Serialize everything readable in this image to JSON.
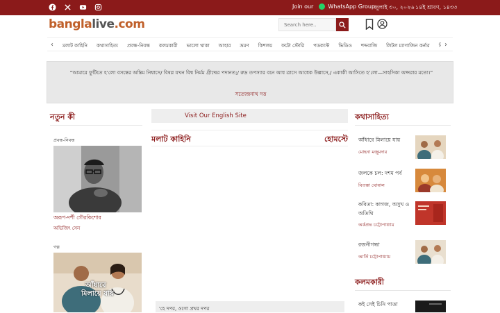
{
  "topbar": {
    "social_icons": [
      "facebook-icon",
      "x-icon",
      "youtube-icon",
      "instagram-icon"
    ],
    "join_label": "Join our",
    "whatsapp_label": "WhatsApp Group",
    "date_bn": "জুলাই ৩০, ২০২৬",
    "date_bangla_calendar": "১৪ই শ্রাবণ, ১৪৩৩"
  },
  "header": {
    "logo": {
      "part1": "bangla",
      "part2": "live",
      "part3": ".com"
    },
    "search_placeholder": "Search here.."
  },
  "nav": {
    "items": [
      "মলাট কাহিনি",
      "কথাসাহিত্য",
      "প্রবন্ধ-নিবন্ধ",
      "কলমকারী",
      "ভালো থাকা",
      "আহার",
      "ভ্রমণ",
      "কিশলয়",
      "ফটো স্টোরি",
      "পডকাস্ট",
      "ভিডিও",
      "শব্দবাজি",
      "লিটল ম্যাগাজিন কর্নার",
      "বিশেষ"
    ]
  },
  "quote": {
    "text": "“আমারে ফুটিতে হ’লো বসন্তের অন্তিম নিশ্বাসে/ বিষণ্ণ যখন বিশ্ব নির্মম গ্রীষ্মের পদানত;/ রুদ্র তপস্যার বনে আধ ত্রাসে আধেক উল্লাসে,/ একাকী আসিতে হ’লো—সাহসিকা অপ্সরার মতো।”",
    "author": "সত্যেন্দ্রনাথ দত্ত"
  },
  "left": {
    "title": "নতুন কী",
    "cards": [
      {
        "category": "প্রবন্ধ-নিবন্ধ",
        "title": "অরূপ-দর্শী গৌরকিশোর",
        "author": "অভিজিৎ সেন"
      },
      {
        "category": "গল্প",
        "image_caption_1": "আঁধারে",
        "image_caption_2": "মিলায়ে যায়"
      }
    ]
  },
  "center": {
    "visit_label": "Visit Our English Site",
    "section_title": "মলাট কাহিনি",
    "section_link": "হোমস্টে",
    "bottom_text": "'হে দপর, ওগো প্রখর দপর"
  },
  "right": {
    "title": "কথাসাহিত্য",
    "items": [
      {
        "title": "আঁধারে মিলায়ে যায়",
        "author": "মোহনা মজুমদার"
      },
      {
        "title": "জলকে চল: দশম পর্ব",
        "author": "বিতস্তা ঘোষাল"
      },
      {
        "title": "কবিতা: কাগজ, অসুখ ও অতিথি",
        "author": "অর্কপ্রভ চট্টোপাধ্যায়"
      },
      {
        "title": "রজনীগন্ধা",
        "author": "আর্তি চট্টোপাধ্যায়"
      }
    ],
    "title2": "কলমকারী",
    "items2": [
      {
        "title": "কই সেই চিনি পাতা"
      }
    ]
  },
  "colors": {
    "brand": "#8b1a1a",
    "logo_accent": "#c0602a"
  }
}
